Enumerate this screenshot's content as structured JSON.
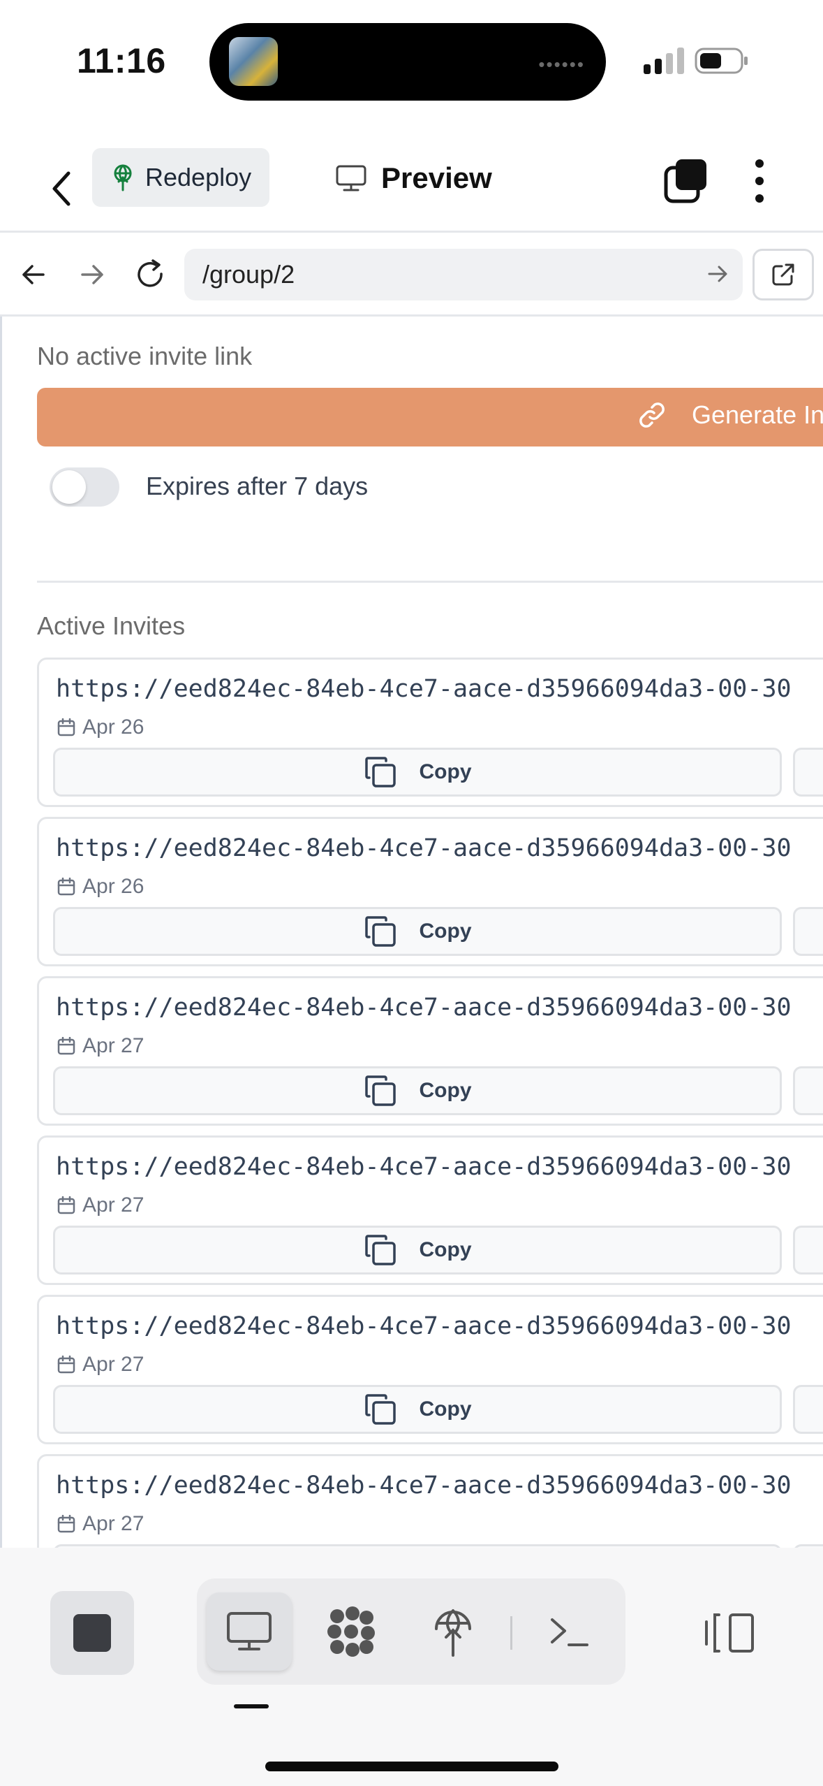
{
  "status_bar": {
    "time": "11:16",
    "island_indicator": "••••••"
  },
  "header": {
    "redeploy_label": "Redeploy",
    "preview_label": "Preview"
  },
  "browser": {
    "url": "/group/2"
  },
  "invite_section": {
    "no_active_label": "No active invite link",
    "generate_label": "Generate Invite Link",
    "expires_label": "Expires after 7 days",
    "expires_enabled": false
  },
  "active_invites": {
    "title": "Active Invites",
    "copy_label": "Copy",
    "items": [
      {
        "url": "https://eed824ec-84eb-4ce7-aace-d35966094da3-00-30",
        "date": "Apr 26"
      },
      {
        "url": "https://eed824ec-84eb-4ce7-aace-d35966094da3-00-30",
        "date": "Apr 26"
      },
      {
        "url": "https://eed824ec-84eb-4ce7-aace-d35966094da3-00-30",
        "date": "Apr 27"
      },
      {
        "url": "https://eed824ec-84eb-4ce7-aace-d35966094da3-00-30",
        "date": "Apr 27"
      },
      {
        "url": "https://eed824ec-84eb-4ce7-aace-d35966094da3-00-30",
        "date": "Apr 27"
      },
      {
        "url": "https://eed824ec-84eb-4ce7-aace-d35966094da3-00-30",
        "date": "Apr 27"
      }
    ]
  },
  "colors": {
    "accent": "#e4976d",
    "redeploy_icon": "#15803d"
  },
  "toolbar": {
    "icons": [
      "stop-icon",
      "monitor-icon",
      "cluster-icon",
      "deploy-icon",
      "terminal-icon",
      "panel-toggle-icon"
    ],
    "active": "monitor-icon"
  }
}
